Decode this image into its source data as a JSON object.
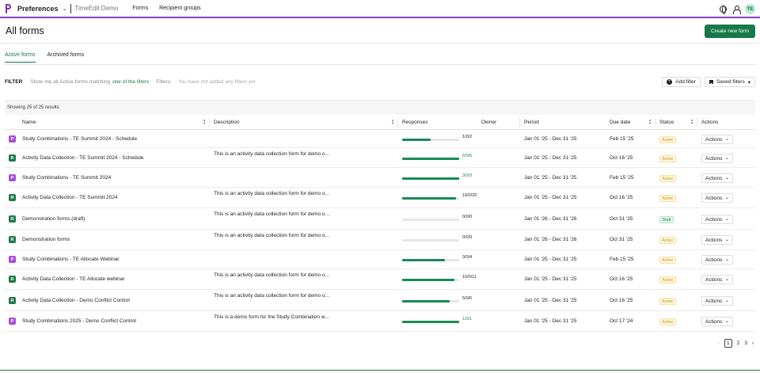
{
  "topbar": {
    "app_name": "Preferences",
    "org_name": "TimeEdit Demo",
    "nav": [
      "Forms",
      "Recipient groups"
    ],
    "avatar_initials": "TE",
    "icons": [
      "globe-icon",
      "user-icon"
    ]
  },
  "page": {
    "title": "All forms",
    "create_button": "Create new form"
  },
  "tabs": [
    {
      "label": "Active forms",
      "active": true
    },
    {
      "label": "Archived forms",
      "active": false
    }
  ],
  "filter": {
    "label": "FILTER",
    "prefix": "Show me all Active forms matching",
    "match_mode": "one of the filters",
    "filters_label": "Filters:",
    "empty_text": "You have not added any filters yet",
    "add_filter": "Add filter",
    "saved_filters": "Saved filters"
  },
  "table": {
    "results_text": "Showing 25 of 25 results",
    "headers": {
      "name": "Name",
      "description": "Description",
      "responses": "Responses",
      "owner": "Owner",
      "period": "Period",
      "due_date": "Due date",
      "status": "Status",
      "actions": "Actions"
    },
    "rows": [
      {
        "type": "P",
        "name": "Study Combinations - TE Summit 2024 - Schedule",
        "description": "",
        "responses": "1/0/2",
        "progress": 0.5,
        "green": false,
        "period": "Jan 01 '25 - Dec 31 '25",
        "due": "Feb 15 '25",
        "status": "Active",
        "action": "Actions"
      },
      {
        "type": "R",
        "name": "Activity Data Collection - TE Summit 2024 - Schedule",
        "description": "This is an activity data collection form for demo o…",
        "responses": "6/0/6",
        "progress": 1.0,
        "green": true,
        "period": "Jan 01 '25 - Dec 31 '25",
        "due": "Oct 16 '25",
        "status": "Active",
        "action": "Actions"
      },
      {
        "type": "P",
        "name": "Study Combinations - TE Summit 2024",
        "description": "",
        "responses": "3/0/3",
        "progress": 1.0,
        "green": true,
        "period": "Jan 01 '25 - Dec 31 '25",
        "due": "Feb 15 '25",
        "status": "Active",
        "action": "Actions"
      },
      {
        "type": "R",
        "name": "Activity Data Collection - TE Summit 2024",
        "description": "This is an activity data collection form for demo o…",
        "responses": "19/0/20",
        "progress": 0.95,
        "green": false,
        "period": "Jan 01 '25 - Dec 31 '25",
        "due": "Oct 16 '25",
        "status": "Active",
        "action": "Actions"
      },
      {
        "type": "R",
        "name": "Demonstration forms (draft)",
        "description": "This is an activity data collection form for demo o…",
        "responses": "0/0/0",
        "progress": 0,
        "green": false,
        "period": "Jan 01 '26 - Dec 31 '26",
        "due": "Oct 31 '25",
        "status": "Draft",
        "action": "Actions"
      },
      {
        "type": "R",
        "name": "Demonstration forms",
        "description": "This is an activity data collection form for demo o…",
        "responses": "0/0/9",
        "progress": 0,
        "green": false,
        "period": "Jan 01 '26 - Dec 31 '26",
        "due": "Oct 31 '25",
        "status": "Active",
        "action": "Actions"
      },
      {
        "type": "P",
        "name": "Study Combinations - TE Allocate Webinar",
        "description": "",
        "responses": "3/0/4",
        "progress": 0.75,
        "green": false,
        "period": "Jan 01 '25 - Dec 31 '25",
        "due": "Feb 15 '25",
        "status": "Active",
        "action": "Actions"
      },
      {
        "type": "R",
        "name": "Activity Data Collection - TE Allocate webinar",
        "description": "This is an activity data collection form for demo o…",
        "responses": "10/0/11",
        "progress": 0.91,
        "green": false,
        "period": "Jan 01 '25 - Dec 31 '25",
        "due": "Oct 16 '25",
        "status": "Active",
        "action": "Actions"
      },
      {
        "type": "R",
        "name": "Activity Data Collection - Demo Conflict Control",
        "description": "This is an activity data collection form for demo o…",
        "responses": "5/0/6",
        "progress": 0.83,
        "green": false,
        "period": "Jan 01 '25 - Dec 31 '25",
        "due": "Oct 16 '25",
        "status": "Active",
        "action": "Actions"
      },
      {
        "type": "P",
        "name": "Study Combinations 2025 - Demo Conflict Control",
        "description": "This is a demo form for the Study Combination w…",
        "responses": "1/0/1",
        "progress": 1.0,
        "green": true,
        "period": "Jan 01 '25 - Dec 31 '25",
        "due": "Oct 17 '24",
        "status": "Active",
        "action": "Actions"
      }
    ]
  },
  "pagination": {
    "prev": "‹",
    "pages": [
      "1",
      "2",
      "3"
    ],
    "current": "1",
    "next": "›"
  },
  "colors": {
    "accent": "#17794a",
    "brand_purple": "#8b3fc2",
    "status_active": "#c8961a"
  }
}
